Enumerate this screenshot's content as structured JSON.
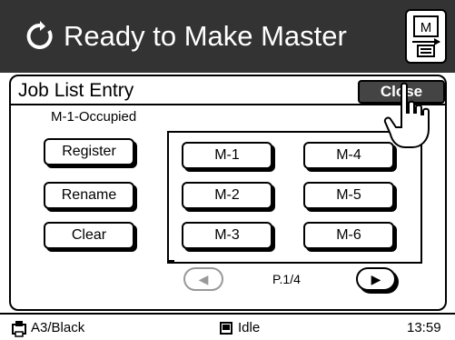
{
  "header": {
    "title": "Ready to Make Master",
    "status_icon": "refresh-icon",
    "master_button_icon": "master-document-icon",
    "master_button_letter": "M"
  },
  "panel": {
    "title": "Job List Entry",
    "close_label": "Close",
    "status_text": "M-1-Occupied",
    "actions": [
      "Register",
      "Rename",
      "Clear"
    ],
    "slots": [
      "M-1",
      "M-2",
      "M-3",
      "M-4",
      "M-5",
      "M-6"
    ],
    "pager": {
      "label": "P.1/4",
      "prev_icon": "arrow-left-icon",
      "next_icon": "arrow-right-icon"
    }
  },
  "statusbar": {
    "paper": "A3/Black",
    "state": "Idle",
    "time": "13:59"
  },
  "colors": {
    "header_bg": "#333333",
    "close_bg": "#444444"
  }
}
